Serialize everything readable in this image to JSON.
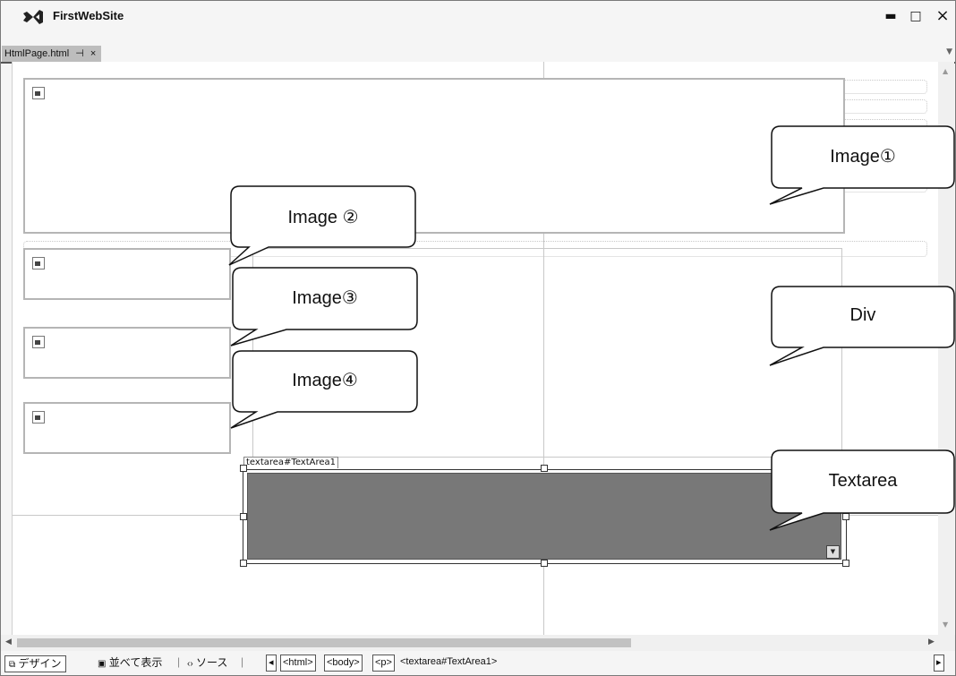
{
  "window": {
    "title": "FirstWebSite",
    "minimize": "▬",
    "maximize": "□",
    "close": "×"
  },
  "tab": {
    "label": "HtmlPage.html",
    "pin": "⊣",
    "close": "×"
  },
  "designer": {
    "textarea_tag": "textarea#TextArea1"
  },
  "callouts": {
    "image1": "Image①",
    "image2": "Image ②",
    "image3": "Image③",
    "image4": "Image④",
    "div": "Div",
    "textarea": "Textarea"
  },
  "statusbar": {
    "design": "デザイン",
    "split": "並べて表示",
    "source": "ソース",
    "breadcrumbs": [
      "<html>",
      "<body>",
      "<p>"
    ],
    "current": "<textarea#TextArea1>"
  },
  "colors": {
    "textarea_fill": "#787878",
    "vs_logo": "#222222"
  }
}
